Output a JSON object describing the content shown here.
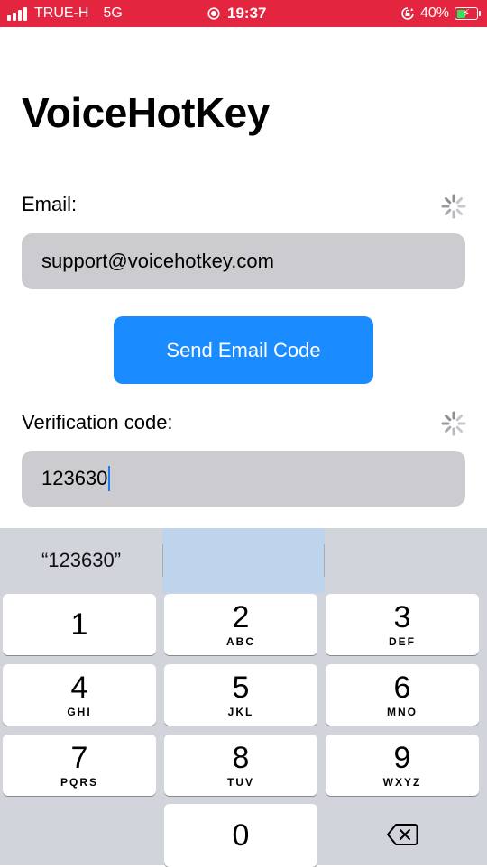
{
  "status_bar": {
    "carrier": "TRUE-H",
    "network": "5G",
    "time": "19:37",
    "battery": "40%",
    "background_color": "#e4253f"
  },
  "app": {
    "title": "VoiceHotKey"
  },
  "form": {
    "email_label": "Email:",
    "email_value": "support@voicehotkey.com",
    "send_button_label": "Send Email Code",
    "verification_label": "Verification code:",
    "verification_value": "123630",
    "accent_color": "#1a8cff"
  },
  "keyboard": {
    "suggestion": "“123630”",
    "keys": [
      {
        "digit": "1",
        "letters": ""
      },
      {
        "digit": "2",
        "letters": "ABC"
      },
      {
        "digit": "3",
        "letters": "DEF"
      },
      {
        "digit": "4",
        "letters": "GHI"
      },
      {
        "digit": "5",
        "letters": "JKL"
      },
      {
        "digit": "6",
        "letters": "MNO"
      },
      {
        "digit": "7",
        "letters": "PQRS"
      },
      {
        "digit": "8",
        "letters": "TUV"
      },
      {
        "digit": "9",
        "letters": "WXYZ"
      },
      {
        "digit": "0",
        "letters": ""
      }
    ],
    "delete_icon": "backspace-icon"
  }
}
